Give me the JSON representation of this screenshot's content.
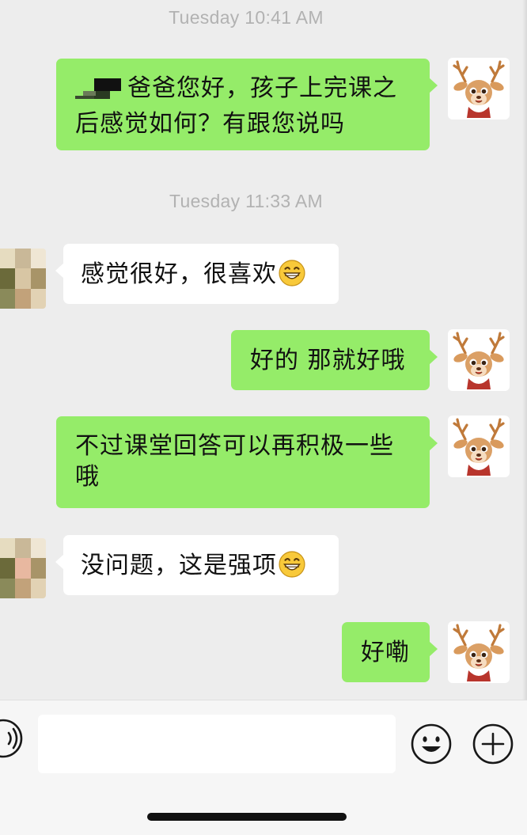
{
  "chat": {
    "timestamps": [
      "Tuesday 10:41 AM",
      "Tuesday 11:33 AM"
    ],
    "messages": [
      {
        "side": "out",
        "line1": "爸爸您好，孩子上完课之",
        "line2": "后感觉如何？有跟您说吗"
      },
      {
        "side": "in",
        "text": "感觉很好，很喜欢",
        "emoji": "grin-emoji"
      },
      {
        "side": "out",
        "text": "好的 那就好哦"
      },
      {
        "side": "out",
        "line1": "不过课堂回答可以再积极一些",
        "line2": "哦"
      },
      {
        "side": "in",
        "text": "没问题，这是强项",
        "emoji": "grin-emoji"
      },
      {
        "side": "out",
        "text": "好嘞"
      }
    ],
    "self_avatar": "deer-avatar",
    "contact_avatar": "pixelated-avatar"
  },
  "input_bar": {
    "placeholder": "",
    "icons": [
      "voice-icon",
      "emoji-icon",
      "plus-icon"
    ]
  },
  "colors": {
    "background": "#ededed",
    "outgoing_bubble": "#95ec69",
    "incoming_bubble": "#ffffff",
    "timestamp": "#b2b2b2"
  }
}
